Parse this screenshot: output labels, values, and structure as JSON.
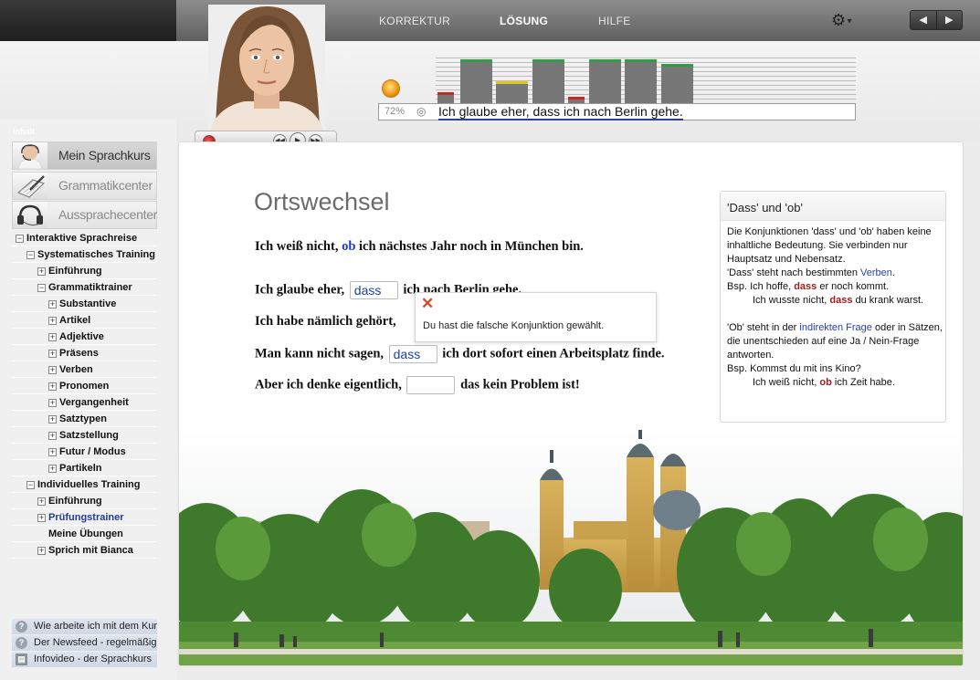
{
  "topbar": {
    "nav": [
      {
        "label": "KORREKTUR",
        "active": false
      },
      {
        "label": "LÖSUNG",
        "active": true
      },
      {
        "label": "HILFE",
        "active": false
      }
    ],
    "gear_icon": "gear-icon",
    "prev_glyph": "◀",
    "next_glyph": "▶"
  },
  "speech": {
    "score": "72%",
    "phrase": "Ich glaube eher, dass ich nach Berlin gehe.",
    "bar_levels": [
      0.25,
      1.0,
      0.5,
      1.0,
      0.15,
      1.0,
      1.0,
      0.9
    ],
    "bar_colors": [
      "#c62828",
      "#2ea043",
      "#e6c619",
      "#2ea043",
      "#c62828",
      "#2ea043",
      "#2ea043",
      "#2ea043"
    ]
  },
  "sidebar": {
    "heading": "Inhalt",
    "sections": [
      {
        "label": "Mein Sprachkurs",
        "icon": "headset-person-icon"
      },
      {
        "label": "Grammatikcenter",
        "icon": "notebook-pen-icon"
      },
      {
        "label": "Aussprachecenter",
        "icon": "headphones-icon"
      }
    ],
    "tree": [
      {
        "label": "Interaktive Sprachreise",
        "level": 0,
        "expander": "−"
      },
      {
        "label": "Systematisches Training",
        "level": 1,
        "expander": "−"
      },
      {
        "label": "Einführung",
        "level": 2,
        "expander": "+"
      },
      {
        "label": "Grammatiktrainer",
        "level": 2,
        "expander": "−"
      },
      {
        "label": "Substantive",
        "level": 3,
        "expander": "+"
      },
      {
        "label": "Artikel",
        "level": 3,
        "expander": "+"
      },
      {
        "label": "Adjektive",
        "level": 3,
        "expander": "+"
      },
      {
        "label": "Präsens",
        "level": 3,
        "expander": "+"
      },
      {
        "label": "Verben",
        "level": 3,
        "expander": "+"
      },
      {
        "label": "Pronomen",
        "level": 3,
        "expander": "+"
      },
      {
        "label": "Vergangenheit",
        "level": 3,
        "expander": "+"
      },
      {
        "label": "Satztypen",
        "level": 3,
        "expander": "+"
      },
      {
        "label": "Satzstellung",
        "level": 3,
        "expander": "+"
      },
      {
        "label": "Futur / Modus",
        "level": 3,
        "expander": "+"
      },
      {
        "label": "Partikeln",
        "level": 3,
        "expander": "+"
      },
      {
        "label": "Individuelles Training",
        "level": 1,
        "expander": "−"
      },
      {
        "label": "Einführung",
        "level": 2,
        "expander": "+"
      },
      {
        "label": "Prüfungstrainer",
        "level": 2,
        "expander": "+",
        "link": true
      },
      {
        "label": "Meine Übungen",
        "level": 2,
        "expander": ""
      },
      {
        "label": "Sprich mit Bianca",
        "level": 2,
        "expander": "+"
      }
    ],
    "help": [
      {
        "label": "Wie arbeite ich mit dem Kurs?",
        "icon": "help-icon"
      },
      {
        "label": "Der Newsfeed - regelmäßig",
        "icon": "help-icon"
      },
      {
        "label": "Infovideo - der Sprachkurs",
        "icon": "film-icon"
      }
    ]
  },
  "exercise": {
    "title": "Ortswechsel",
    "s1_pre": "Ich weiß nicht, ",
    "s1_kw": "ob",
    "s1_post": " ich nächstes Jahr noch in München bin.",
    "s2_pre": "Ich glaube eher, ",
    "s2_value": "dass",
    "s2_post": " ich nach Berlin gehe.",
    "s3_pre": "Ich habe nämlich gehört, ",
    "s4_pre": "Man kann nicht sagen, ",
    "s4_value": "dass",
    "s4_post": " ich dort sofort einen Arbeitsplatz finde.",
    "s5_pre": "Aber ich denke eigentlich, ",
    "s5_value": "",
    "s5_post": " das kein Problem ist!",
    "error_icon": "✕",
    "error_msg": "Du hast die falsche Konjunktion gewählt."
  },
  "info": {
    "title": "'Dass' und 'ob'",
    "p1": "Die Konjunktionen 'dass' und 'ob' haben keine inhaltliche Bedeutung. Sie verbinden nur Hauptsatz und Nebensatz.",
    "p2_pre": "'Dass' steht nach bestimmten ",
    "p2_link": "Verben",
    "p2_post": ".",
    "ex1_pre": "Bsp. Ich hoffe, ",
    "ex1_kw": "dass",
    "ex1_post": " er noch kommt.",
    "ex2_pre": "Ich wusste nicht, ",
    "ex2_kw": "dass",
    "ex2_post": " du krank warst.",
    "p3_pre": "'Ob' steht in der ",
    "p3_link": "indirekten Frage",
    "p3_post": " oder in Sätzen, die unentschieden auf eine Ja / Nein-Frage antworten.",
    "ex3": "Bsp. Kommst du mit ins Kino?",
    "ex4_pre": "Ich weiß nicht, ",
    "ex4_kw": "ob",
    "ex4_post": " ich Zeit habe."
  }
}
